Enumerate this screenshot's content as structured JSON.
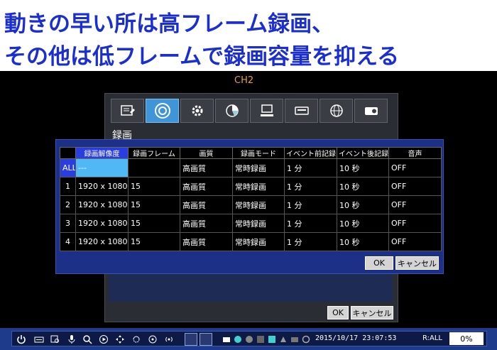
{
  "headline": {
    "line1": "動きの早い所は高フレーム録画、",
    "line2": "その他は低フレームで録画容量を抑える"
  },
  "channel": {
    "label": "CH2"
  },
  "bg_dialog": {
    "title": "録画",
    "tabs": [
      {
        "icon": "record-settings-icon"
      },
      {
        "icon": "disc-icon"
      },
      {
        "icon": "gear-icon"
      },
      {
        "icon": "pie-chart-icon"
      },
      {
        "icon": "computer-icon"
      },
      {
        "icon": "keyboard-icon"
      },
      {
        "icon": "globe-icon"
      },
      {
        "icon": "camera-icon"
      }
    ],
    "ok_label": "OK",
    "cancel_label": "キャンセル"
  },
  "record_table": {
    "headers": [
      "",
      "録画解像度",
      "録画フレーム",
      "画質",
      "録画モード",
      "イベント前記録",
      "イベント後記録",
      "音声"
    ],
    "rows": [
      {
        "label": "ALL",
        "resolution": "---",
        "frame": "",
        "quality": "高画質",
        "mode": "常時録画",
        "pre": "1 分",
        "post": "10 秒",
        "audio": "OFF"
      },
      {
        "label": "1",
        "resolution": "1920 x 1080",
        "frame": "15",
        "quality": "高画質",
        "mode": "常時録画",
        "pre": "1 分",
        "post": "10 秒",
        "audio": "OFF"
      },
      {
        "label": "2",
        "resolution": "1920 x 1080",
        "frame": "15",
        "quality": "高画質",
        "mode": "常時録画",
        "pre": "1 分",
        "post": "10 秒",
        "audio": "OFF"
      },
      {
        "label": "3",
        "resolution": "1920 x 1080",
        "frame": "15",
        "quality": "高画質",
        "mode": "常時録画",
        "pre": "1 分",
        "post": "10 秒",
        "audio": "OFF"
      },
      {
        "label": "4",
        "resolution": "1920 x 1080",
        "frame": "15",
        "quality": "高画質",
        "mode": "常時録画",
        "pre": "1 分",
        "post": "10 秒",
        "audio": "OFF"
      }
    ],
    "ok_label": "OK",
    "cancel_label": "キャンセル"
  },
  "taskbar": {
    "datetime": "2015/10/17 23:07:53",
    "record_status": "R:ALL",
    "percent": "0%"
  },
  "colors": {
    "headline_blue": "#1b2fd0",
    "accent_blue": "#2a3ee0",
    "tab_active": "#3f95d8",
    "channel_label": "#e0a050"
  }
}
